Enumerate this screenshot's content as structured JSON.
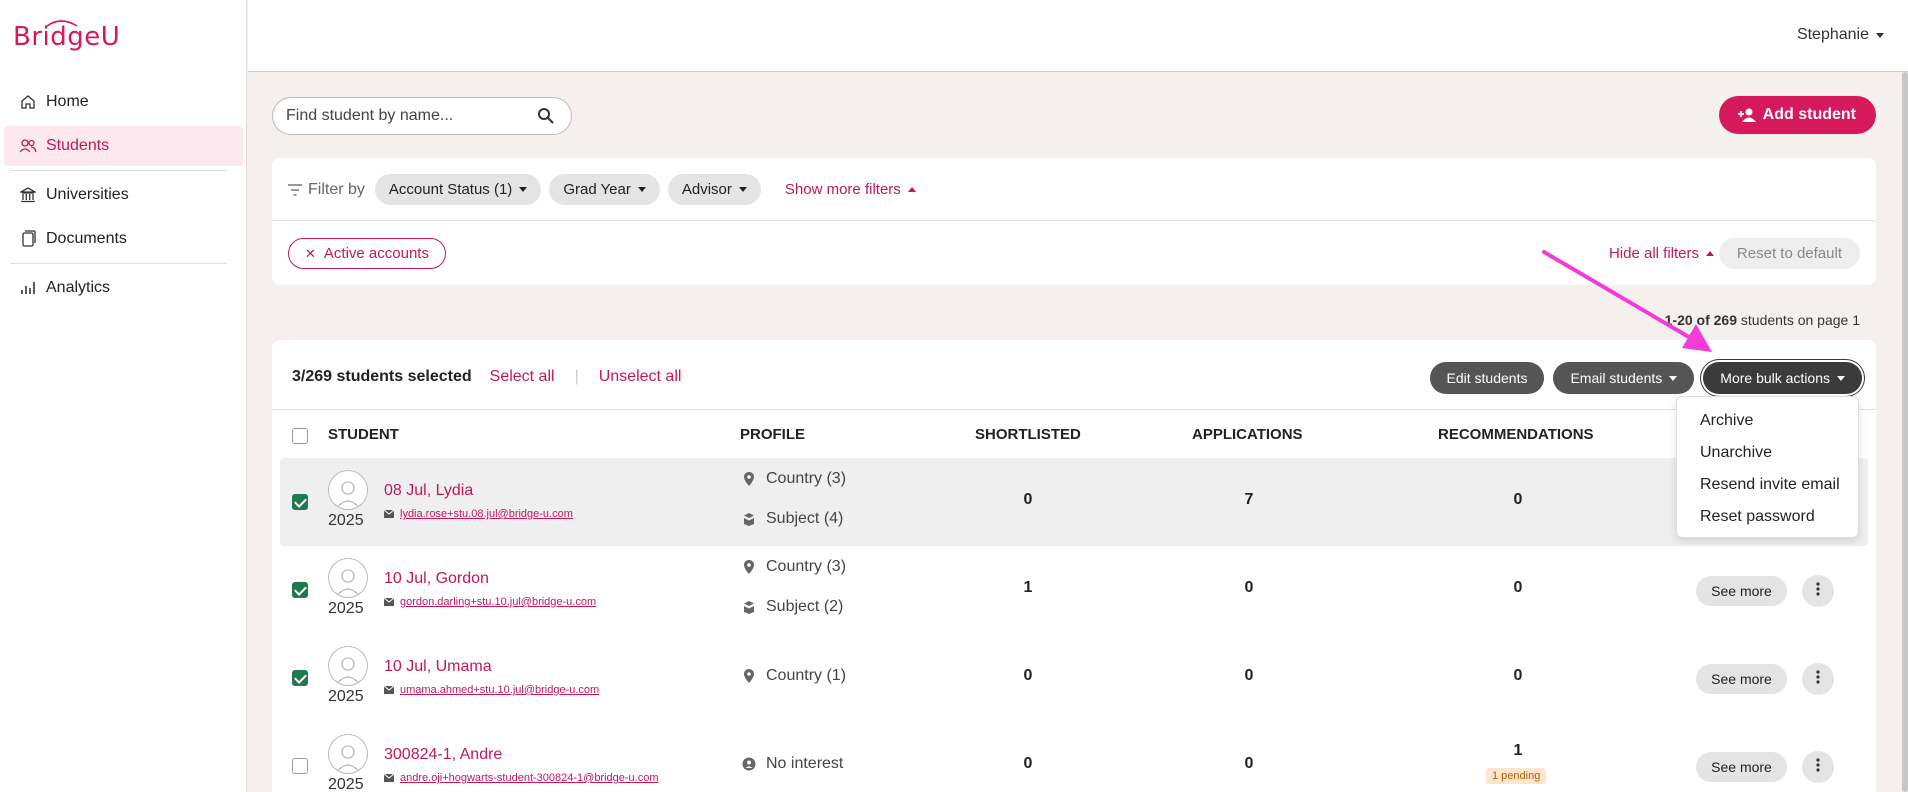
{
  "app": {
    "logo": "BridgeU",
    "brand_color": "#d6195b"
  },
  "sidebar": {
    "items": [
      {
        "label": "Home",
        "icon": "home-icon",
        "active": false
      },
      {
        "label": "Students",
        "icon": "users-icon",
        "active": true
      },
      {
        "label": "Universities",
        "icon": "bank-icon",
        "active": false
      },
      {
        "label": "Documents",
        "icon": "document-icon",
        "active": false
      },
      {
        "label": "Analytics",
        "icon": "chart-icon",
        "active": false
      }
    ]
  },
  "header": {
    "user_name": "Stephanie"
  },
  "search": {
    "placeholder": "Find student by name...",
    "value": ""
  },
  "add_student_label": "Add student",
  "filters": {
    "filter_by_label": "Filter by",
    "chips": [
      "Account Status (1)",
      "Grad Year",
      "Advisor"
    ],
    "show_more_label": "Show more filters",
    "active_filter": "Active accounts",
    "hide_all_label": "Hide all filters",
    "reset_label": "Reset to default"
  },
  "pagination": {
    "range": "1-20 of 269",
    "suffix": "students on page 1"
  },
  "selection": {
    "count_text": "3/269 students selected",
    "select_all": "Select all",
    "unselect_all": "Unselect all"
  },
  "bulk_actions": {
    "edit": "Edit students",
    "email": "Email students",
    "more": "More bulk actions",
    "menu": [
      "Archive",
      "Unarchive",
      "Resend invite email",
      "Reset password"
    ]
  },
  "table": {
    "headers": {
      "student": "STUDENT",
      "profile": "PROFILE",
      "shortlisted": "SHORTLISTED",
      "applications": "APPLICATIONS",
      "recommendations": "RECOMMENDATIONS"
    },
    "see_more_label": "See more",
    "rows": [
      {
        "checked": true,
        "name": "08 Jul, Lydia",
        "email": "lydia.rose+stu.08.jul@bridge-u.com",
        "year": "2025",
        "profile": [
          {
            "icon": "location-pin-icon",
            "text": "Country (3)"
          },
          {
            "icon": "subject-icon",
            "text": "Subject (4)"
          }
        ],
        "shortlisted": "0",
        "applications": "7",
        "recommendations": "0",
        "pending": ""
      },
      {
        "checked": true,
        "name": "10 Jul, Gordon",
        "email": "gordon.darling+stu.10.jul@bridge-u.com",
        "year": "2025",
        "profile": [
          {
            "icon": "location-pin-icon",
            "text": "Country (3)"
          },
          {
            "icon": "subject-icon",
            "text": "Subject (2)"
          }
        ],
        "shortlisted": "1",
        "applications": "0",
        "recommendations": "0",
        "pending": ""
      },
      {
        "checked": true,
        "name": "10 Jul, Umama",
        "email": "umama.ahmed+stu.10.jul@bridge-u.com",
        "year": "2025",
        "profile": [
          {
            "icon": "location-pin-icon",
            "text": "Country (1)"
          }
        ],
        "shortlisted": "0",
        "applications": "0",
        "recommendations": "0",
        "pending": ""
      },
      {
        "checked": false,
        "name": "300824-1, Andre",
        "email": "andre.oji+hogwarts-student-300824-1@bridge-u.com",
        "year": "2025",
        "profile": [
          {
            "icon": "no-interest-icon",
            "text": "No interest"
          }
        ],
        "shortlisted": "0",
        "applications": "0",
        "recommendations": "1",
        "pending": "1 pending"
      }
    ]
  },
  "annotation": {
    "color": "#f23bd9"
  }
}
